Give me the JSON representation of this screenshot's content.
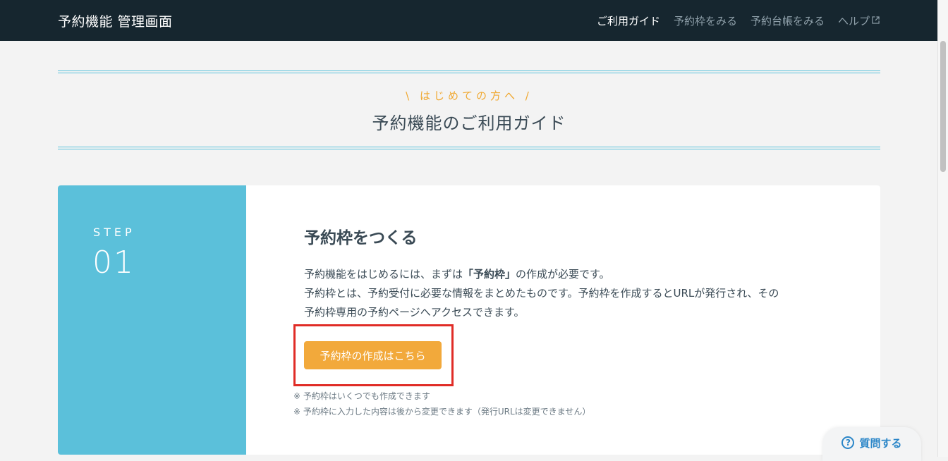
{
  "header": {
    "title": "予約機能 管理画面",
    "nav": [
      {
        "label": "ご利用ガイド",
        "active": true
      },
      {
        "label": "予約枠をみる",
        "active": false
      },
      {
        "label": "予約台帳をみる",
        "active": false
      },
      {
        "label": "ヘルプ",
        "active": false,
        "icon": "external-link-icon"
      }
    ]
  },
  "guide": {
    "eyebrow": "\\ はじめての方へ /",
    "title": "予約機能のご利用ガイド"
  },
  "step": {
    "label": "STEP",
    "number": "01",
    "title": "予約枠をつくる",
    "desc_line1_pre": "予約機能をはじめるには、まずは",
    "desc_line1_strong": "「予約枠」",
    "desc_line1_post": "の作成が必要です。",
    "desc_line2": "予約枠とは、予約受付に必要な情報をまとめたものです。予約枠を作成するとURLが発行され、その",
    "desc_line3": "予約枠専用の予約ページへアクセスできます。",
    "button_label": "予約枠の作成はこちら",
    "notes": [
      "※ 予約枠はいくつでも作成できます",
      "※ 予約枠に入力した内容は後から変更できます（発行URLは変更できません）"
    ]
  },
  "ask": {
    "label": "質問する",
    "icon": "question-circle-icon"
  },
  "colors": {
    "header_bg": "#16262f",
    "accent_blue": "#5bc0da",
    "accent_orange": "#f2a93b",
    "highlight_red": "#e02c26",
    "link_blue": "#2b86c8"
  }
}
